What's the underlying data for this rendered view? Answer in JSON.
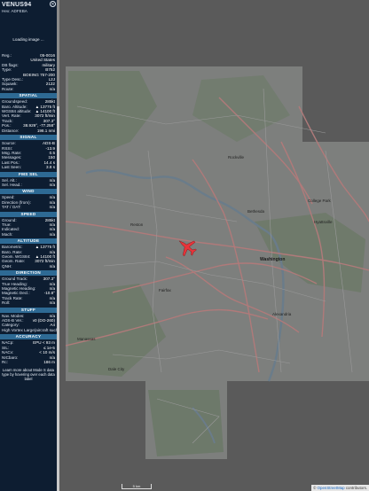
{
  "sidebar": {
    "callsign": "VENUS94",
    "hex_label": "Hex:",
    "hex": "ADFEBA",
    "loading": "Loading image ...",
    "general": [
      {
        "k": "Reg.:",
        "v": "05-0016"
      },
      {
        "k": "",
        "v": "United States"
      },
      {
        "k": "DB flags:",
        "v": "military"
      },
      {
        "k": "Type:",
        "v": "B752"
      },
      {
        "k": "",
        "v": "BOEING 757-200"
      },
      {
        "k": "Type Desc.:",
        "v": "L2J"
      },
      {
        "k": "Squawk:",
        "v": "2122"
      },
      {
        "k": "Route:",
        "v": "n/a"
      }
    ],
    "sections": [
      {
        "title": "SPATIAL",
        "rows": [
          {
            "k": "Groundspeed:",
            "v": "285kt"
          },
          {
            "k": "Baro. Altitude:",
            "v": "▲ 13775 ft"
          },
          {
            "k": "WGS84 altitude:",
            "v": "▲ 14100 ft"
          },
          {
            "k": "Vert. Rate:",
            "v": "3072 ft/min"
          },
          {
            "k": "Track:",
            "v": "307.3°"
          },
          {
            "k": "Pos.:",
            "v": "38.929°, -77.258°"
          },
          {
            "k": "Distance:",
            "v": "198.1 nmi"
          }
        ]
      },
      {
        "title": "SIGNAL",
        "rows": [
          {
            "k": "Source:",
            "v": "ADS-B"
          },
          {
            "k": "RSSI:",
            "v": "-13.9"
          },
          {
            "k": "Msg. Rate:",
            "v": "0.5"
          },
          {
            "k": "Messages:",
            "v": "150"
          },
          {
            "k": "Last Pos.:",
            "v": "14.4 s"
          },
          {
            "k": "Last Seen:",
            "v": "3.8 s"
          }
        ]
      },
      {
        "title": "FMS SEL",
        "rows": [
          {
            "k": "Sel. Alt.:",
            "v": "n/a"
          },
          {
            "k": "Sel. Head.:",
            "v": "n/a"
          }
        ]
      },
      {
        "title": "WIND",
        "rows": [
          {
            "k": "Speed:",
            "v": "n/a"
          },
          {
            "k": "Direction (from):",
            "v": "n/a"
          },
          {
            "k": "TAT / OAT:",
            "v": "n/a"
          }
        ]
      },
      {
        "title": "SPEED",
        "rows": [
          {
            "k": "Ground:",
            "v": "285kt"
          },
          {
            "k": "True:",
            "v": "n/a"
          },
          {
            "k": "Indicated:",
            "v": "n/a"
          },
          {
            "k": "Mach:",
            "v": "n/a"
          }
        ]
      },
      {
        "title": "ALTITUDE",
        "rows": [
          {
            "k": "Barometric:",
            "v": "▲ 13775 ft"
          },
          {
            "k": "Baro. Rate:",
            "v": "n/a"
          },
          {
            "k": "Geom. WGS84:",
            "v": "▲ 14100 ft"
          },
          {
            "k": "Geom. Rate:",
            "v": "3072 ft/min"
          },
          {
            "k": "QNH:",
            "v": "n/a"
          }
        ]
      },
      {
        "title": "DIRECTION",
        "rows": [
          {
            "k": "Ground Track:",
            "v": "307.3°"
          },
          {
            "k": "True Heading:",
            "v": "n/a"
          },
          {
            "k": "Magnetic Heading:",
            "v": "n/a"
          },
          {
            "k": "Magnetic Decl.:",
            "v": "-10.8°"
          },
          {
            "k": "Track Rate:",
            "v": "n/a"
          },
          {
            "k": "Roll:",
            "v": "n/a"
          }
        ]
      },
      {
        "title": "STUFF",
        "rows": [
          {
            "k": "Nav. Modes:",
            "v": "n/a"
          },
          {
            "k": "ADS-B Ver.:",
            "v": "v0 (DO-260)"
          },
          {
            "k": "Category:",
            "v": "A4"
          },
          {
            "k": "High Vortex Large(aircraft such as B-757)",
            "v": ""
          }
        ]
      },
      {
        "title": "ACCURACY",
        "rows": [
          {
            "k": "NACp:",
            "v": "EPU < 93 m"
          },
          {
            "k": "SIL:",
            "v": "≤ 1e-5"
          },
          {
            "k": "NACv:",
            "v": "< 10 m/s"
          },
          {
            "k": "NICbaro:",
            "v": "n/a"
          },
          {
            "k": "Rc:",
            "v": "186 m"
          }
        ]
      }
    ],
    "note": "Learn more about Mode S data type by hovering over each data label"
  },
  "map": {
    "labels": {
      "washington": "Washington",
      "reston": "Reston",
      "fairfax": "Fairfax",
      "bethesda": "Bethesda",
      "manassas": "Manassas",
      "rockville": "Rockville",
      "alexandria": "Alexandria",
      "hyattsville": "Hyattsville",
      "college_park": "College Park",
      "dale_city": "Dale City"
    },
    "scale": "5 km",
    "attribution_prefix": "© ",
    "attribution_link": "OpenStreetMap",
    "attribution_suffix": " contributors.",
    "aircraft_color": "#e8343a"
  }
}
